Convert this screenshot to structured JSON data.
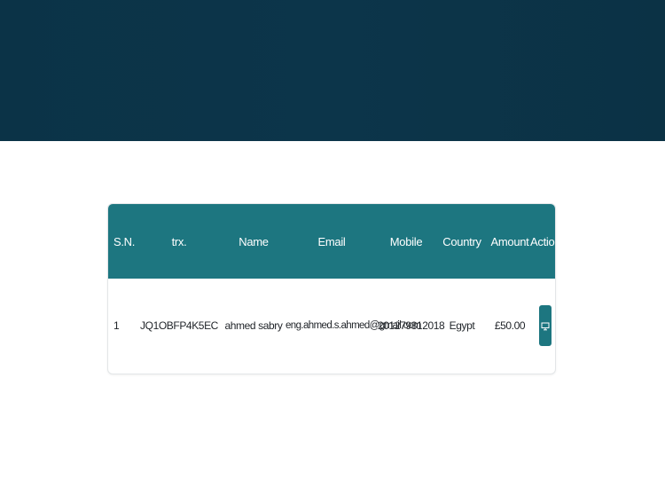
{
  "table": {
    "headers": [
      "S.N.",
      "trx.",
      "Name",
      "Email",
      "Mobile",
      "Country",
      "Amount",
      "Action"
    ],
    "rows": [
      {
        "sn": "1",
        "trx": "JQ1OBFP4K5EC",
        "name": "ahmed sabry",
        "email": "eng.ahmed.s.ahmed@gmail.com",
        "mobile": "201279312018",
        "country": "Egypt",
        "amount": "£50.00",
        "action_icon": "monitor-icon"
      }
    ]
  },
  "colors": {
    "banner": "#0c354a",
    "table_header": "#1d7680",
    "action_button": "#1d7680"
  }
}
